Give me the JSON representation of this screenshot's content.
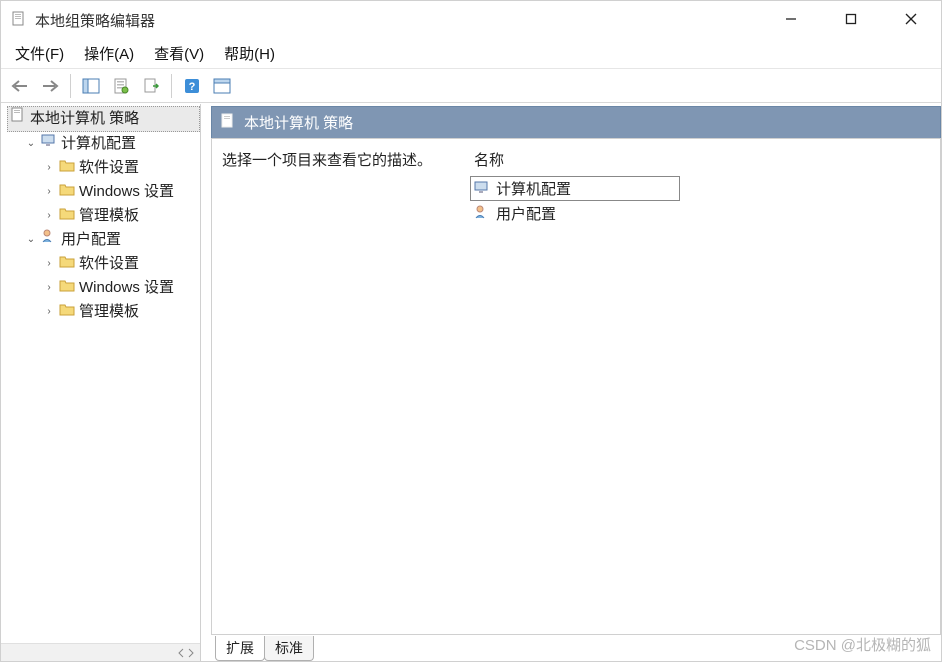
{
  "window": {
    "title": "本地组策略编辑器"
  },
  "menu": {
    "file": "文件(F)",
    "action": "操作(A)",
    "view": "查看(V)",
    "help": "帮助(H)"
  },
  "tree": {
    "root": "本地计算机 策略",
    "computer": {
      "label": "计算机配置",
      "software": "软件设置",
      "windows": "Windows 设置",
      "templates": "管理模板"
    },
    "user": {
      "label": "用户配置",
      "software": "软件设置",
      "windows": "Windows 设置",
      "templates": "管理模板"
    }
  },
  "right": {
    "header": "本地计算机 策略",
    "description_prompt": "选择一个项目来查看它的描述。",
    "column_name": "名称",
    "items": {
      "computer": "计算机配置",
      "user": "用户配置"
    }
  },
  "tabs": {
    "extended": "扩展",
    "standard": "标准"
  },
  "watermark": "CSDN @北极糊的狐"
}
